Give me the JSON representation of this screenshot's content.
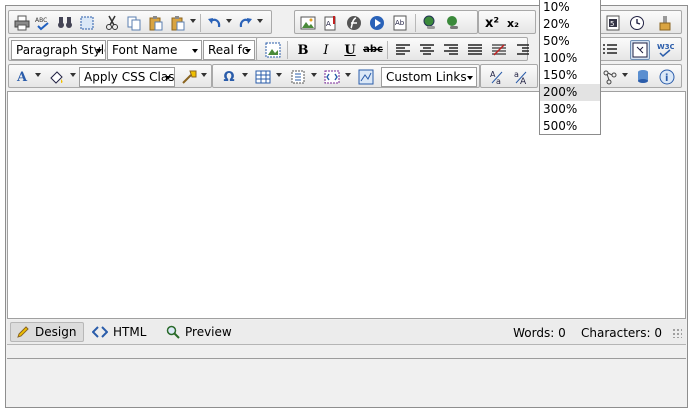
{
  "toolbar1": {
    "icons": [
      "print-icon",
      "spellcheck-icon",
      "find-replace-icon",
      "select-all-icon",
      "cut-icon",
      "copy-icon",
      "paste-icon",
      "paste-options-icon",
      "undo-icon",
      "redo-icon",
      "image-manager-icon",
      "document-manager-icon",
      "flash-manager-icon",
      "media-manager-icon",
      "template-manager-icon",
      "hyperlink-icon",
      "remove-link-icon",
      "superscript-icon",
      "subscript-icon",
      "module-manager-icon",
      "insert-date-icon",
      "format-stripper-icon"
    ]
  },
  "toolbar2": {
    "paragraph_style": "Paragraph Style",
    "font_name": "Font Name",
    "font_size": "Real fc",
    "bold": "B",
    "italic": "I",
    "underline": "U",
    "strike": "abc"
  },
  "toolbar3": {
    "css_class": "Apply CSS Clas",
    "custom_links": "Custom Links",
    "omega": "Ω"
  },
  "zoom_dropdown": {
    "options": [
      "10%",
      "20%",
      "50%",
      "100%",
      "150%",
      "200%",
      "300%",
      "500%"
    ],
    "highlighted": "200%"
  },
  "modes": {
    "design": "Design",
    "html": "HTML",
    "preview": "Preview"
  },
  "stats": {
    "words": "Words: 0",
    "characters": "Characters: 0"
  }
}
